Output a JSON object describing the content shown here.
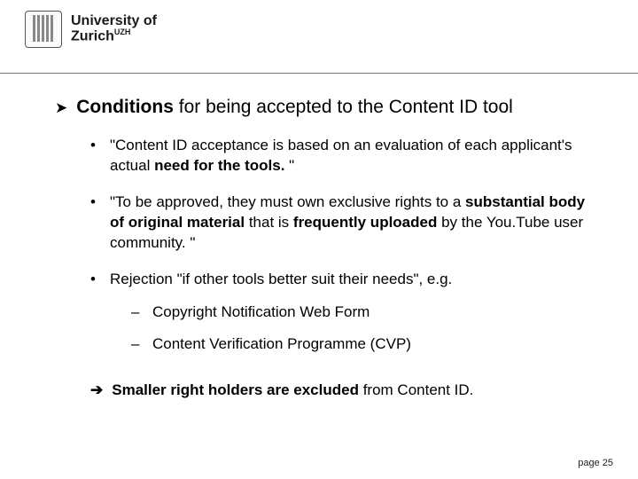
{
  "header": {
    "university_line1": "University of",
    "university_line2_html": "Zurich"
  },
  "main": {
    "title_bold": "Conditions",
    "title_rest": " for being accepted to the Content ID tool",
    "bullet1_pre": "\"Content ID acceptance is based on an evaluation of each applicant's actual ",
    "bullet1_bold": "need for the tools.",
    "bullet1_post": " \"",
    "bullet2_pre": "\"To be approved, they must own exclusive rights to a ",
    "bullet2_bold1": "substantial body of original material",
    "bullet2_mid": " that is ",
    "bullet2_bold2": "frequently uploaded",
    "bullet2_post": " by the You.Tube user community. \"",
    "bullet3": "Rejection \"if other tools better suit their needs\", e.g.",
    "sub_a": "Copyright Notification Web Form",
    "sub_b": "Content Verification Programme (CVP)",
    "arrow_bold": "Smaller right holders are excluded",
    "arrow_rest": " from Content ID."
  },
  "footer": {
    "page_label": "page 25"
  }
}
